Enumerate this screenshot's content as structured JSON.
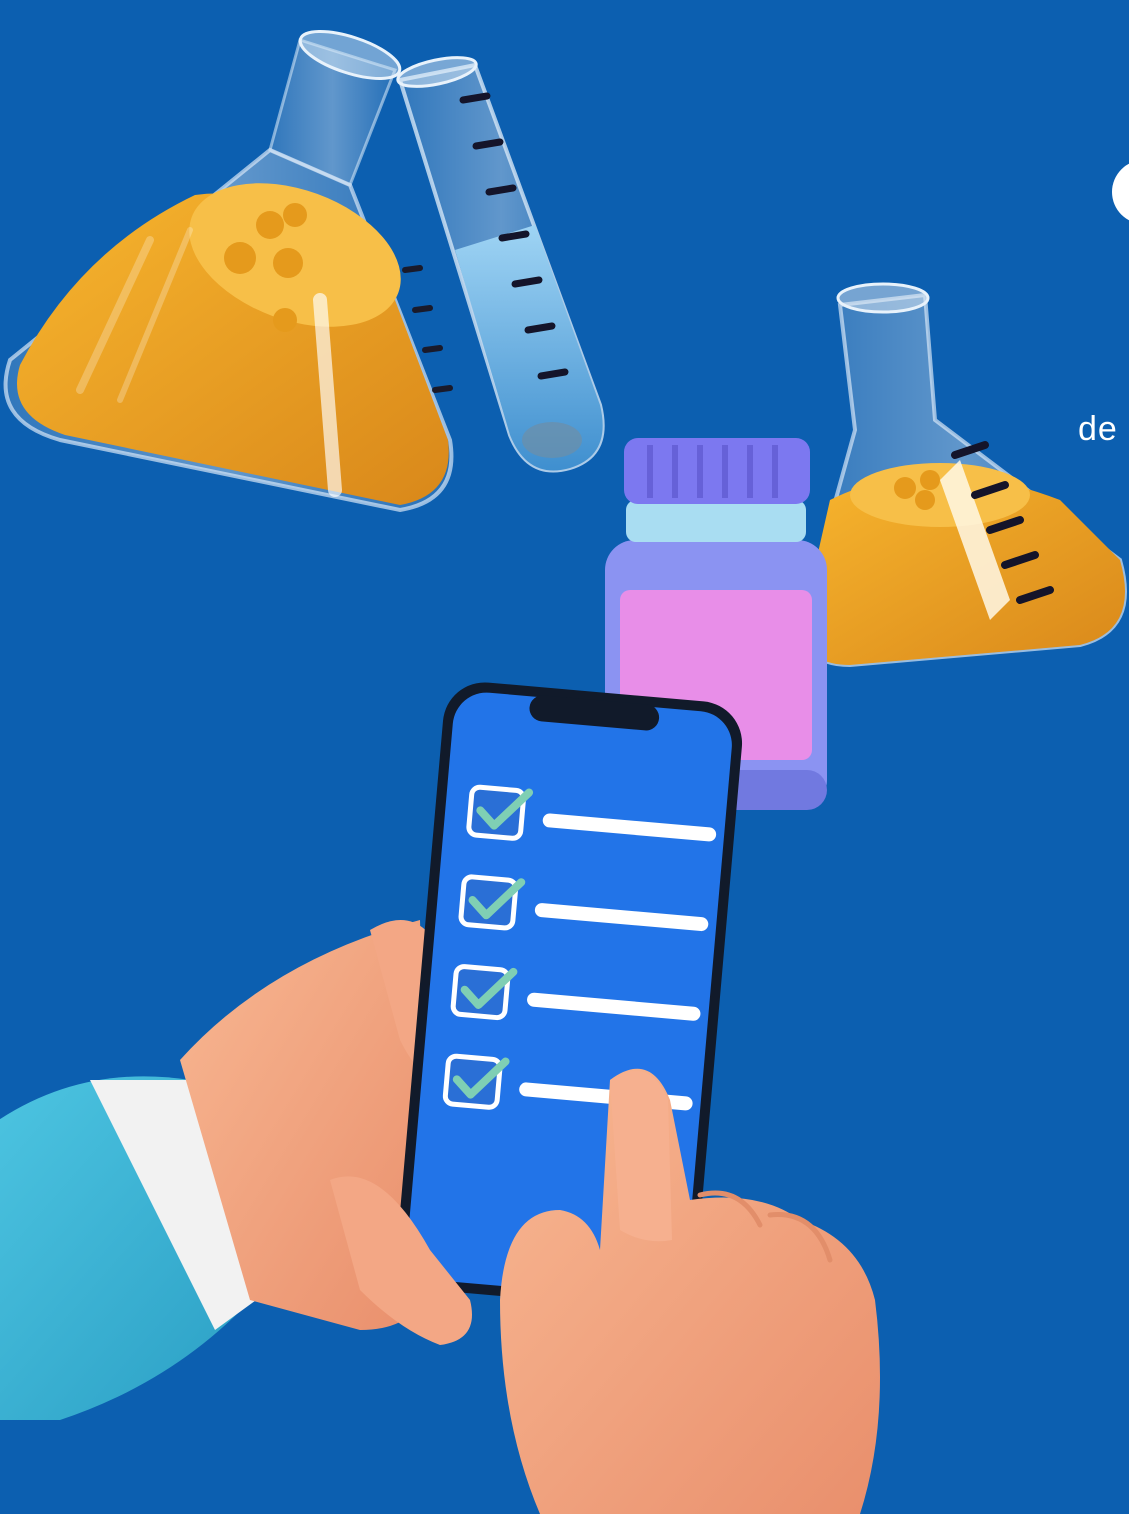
{
  "partial_text": "de",
  "colors": {
    "background": "#0c5fb0",
    "liquid_orange": "#f0a51f",
    "liquid_blue": "#4aa8e8",
    "jar_body": "#8b93f2",
    "jar_lid": "#7c78f0",
    "jar_label": "#e88ee8",
    "phone_screen": "#2274e8",
    "skin": "#f4a27e",
    "sleeve": "#3db6d6",
    "cuff": "#f4f4f4",
    "check": "#7fcfb4"
  },
  "phone": {
    "checklist_items": 4,
    "all_checked": true
  }
}
